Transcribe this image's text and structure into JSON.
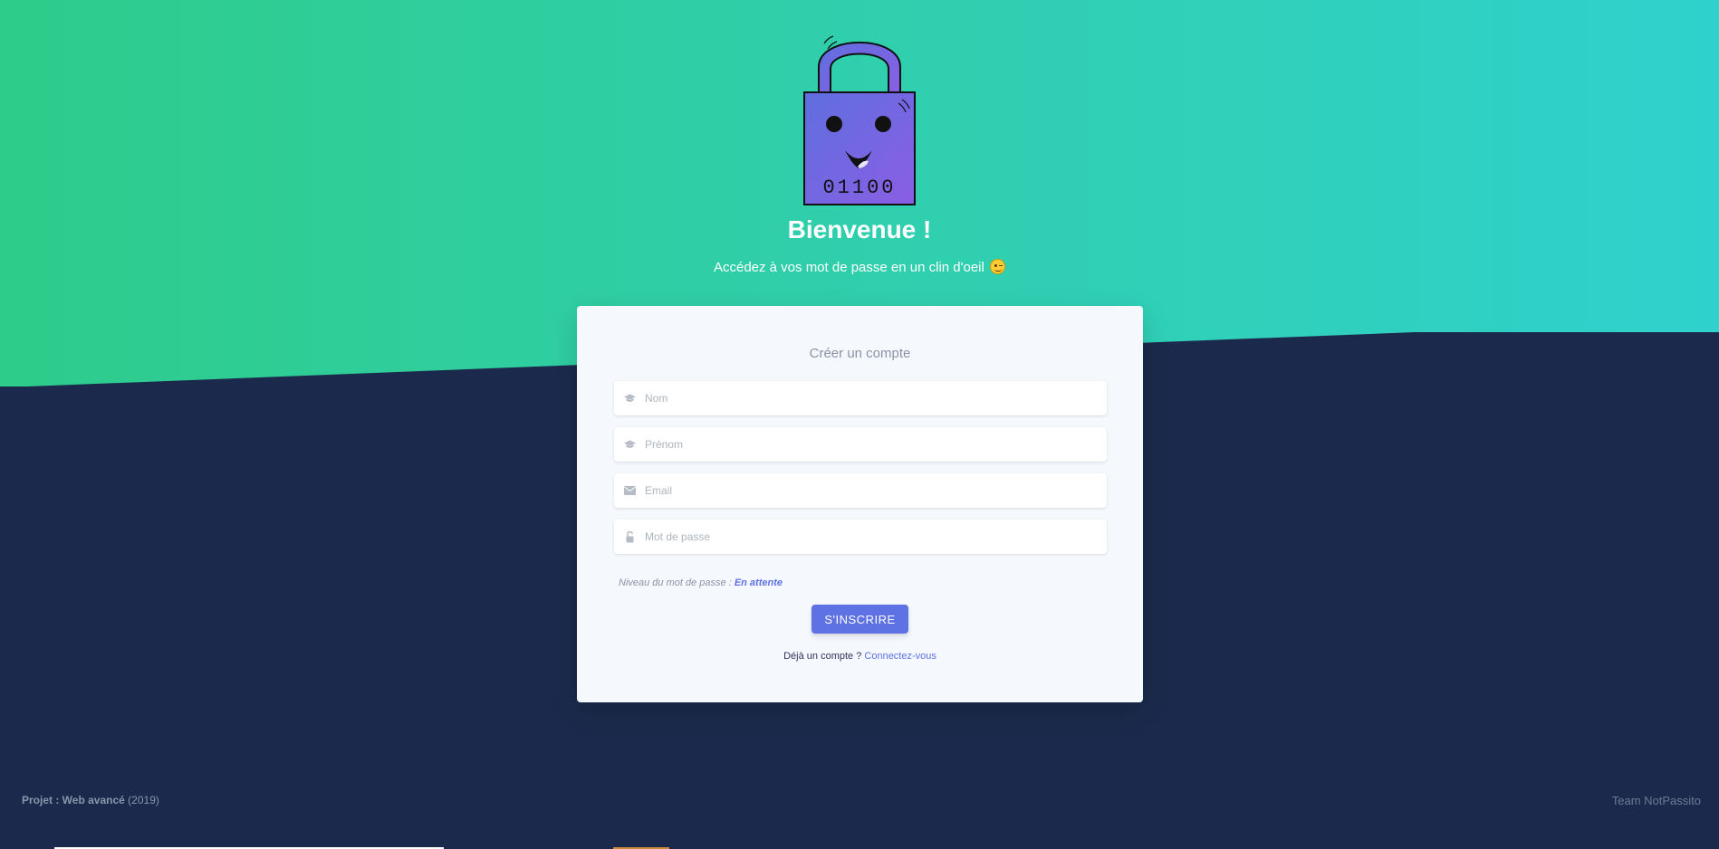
{
  "hero": {
    "logo_text": "01100",
    "title": "Bienvenue !",
    "subtitle": "Accédez à vos mot de passe en un clin d'oeil"
  },
  "form": {
    "heading": "Créer un compte",
    "fields": [
      {
        "placeholder": "Nom",
        "value": "",
        "icon": "graduation-cap-icon"
      },
      {
        "placeholder": "Prénom",
        "value": "",
        "icon": "graduation-cap-icon"
      },
      {
        "placeholder": "Email",
        "value": "",
        "icon": "envelope-icon"
      },
      {
        "placeholder": "Mot de passe",
        "value": "",
        "icon": "unlock-icon"
      }
    ],
    "strength_label": "Niveau du mot de passe :",
    "strength_value": "En attente",
    "submit_label": "S'INSCRIRE",
    "already_text": "Déjà un compte ?",
    "login_link": "Connectez-vous"
  },
  "footer": {
    "project_label": "Projet : Web avancé",
    "year": "(2019)",
    "team": "Team NotPassito"
  },
  "colors": {
    "accent": "#5e72e4",
    "dark_bg": "#1b2a4c",
    "gradient_start": "#2ecc8a",
    "gradient_end": "#2fd1cc",
    "logo_purple": "#7b5fe0"
  }
}
